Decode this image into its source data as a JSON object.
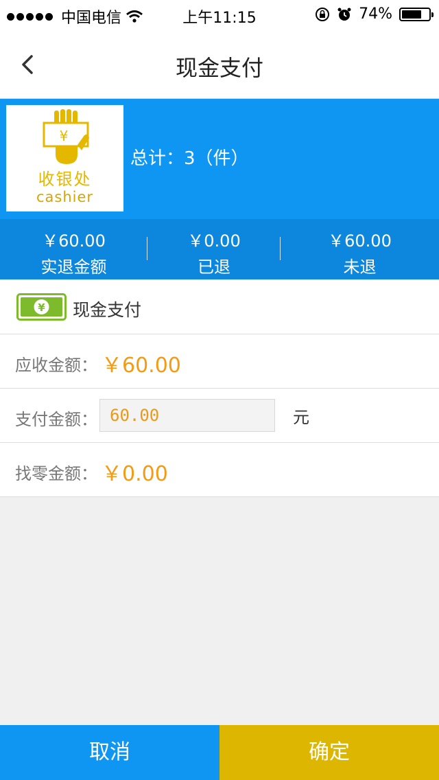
{
  "status_bar": {
    "carrier": "中国电信",
    "time": "上午11:15",
    "battery": "74%",
    "battery_level": 0.74
  },
  "nav": {
    "title": "现金支付",
    "back_icon": "chevron-left-icon"
  },
  "summary": {
    "logo_zh": "收银处",
    "logo_en": "cashier",
    "total": "总计：3（件）",
    "stats": [
      {
        "amount": "￥60.00",
        "label": "实退金额"
      },
      {
        "amount": "￥0.00",
        "label": "已退"
      },
      {
        "amount": "￥60.00",
        "label": "未退"
      }
    ]
  },
  "payment": {
    "method_label": "现金支付",
    "method_icon": "cash-icon",
    "receivable_label": "应收金额：",
    "receivable_value": "￥60.00",
    "paid_label": "支付金额：",
    "paid_value": "60.00",
    "paid_unit": "元",
    "change_label": "找零金额：",
    "change_value": "￥0.00"
  },
  "buttons": {
    "cancel": "取消",
    "confirm": "确定"
  },
  "colors": {
    "primary_blue": "#0f96f3",
    "dark_blue": "#0d87de",
    "gold": "#dcb600",
    "amount_orange": "#f39b12",
    "cash_green": "#7dbb2c"
  }
}
